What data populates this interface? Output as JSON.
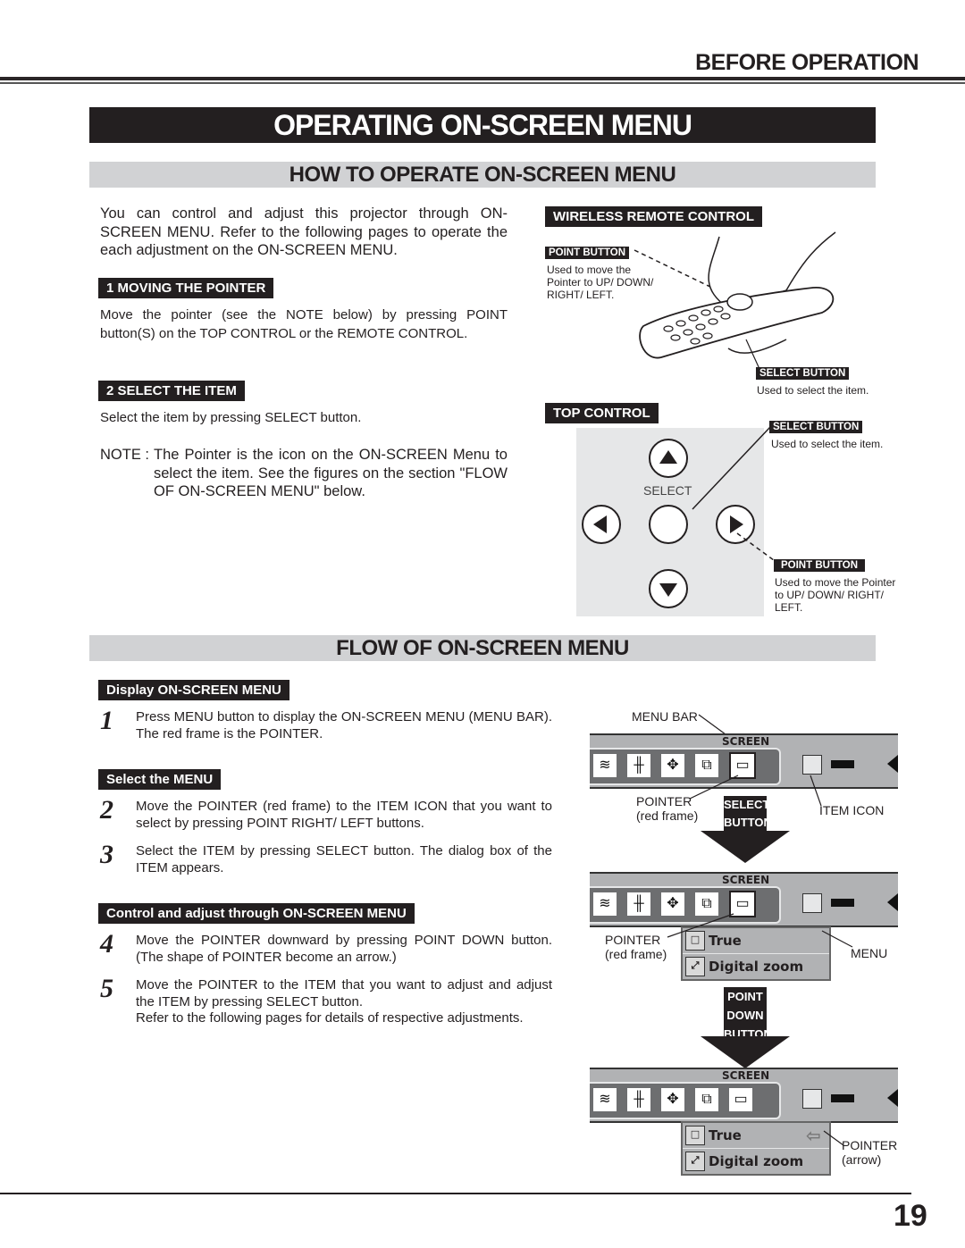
{
  "header": {
    "section": "BEFORE OPERATION",
    "title": "OPERATING ON-SCREEN MENU",
    "page_number": "19"
  },
  "how_to": {
    "heading": "HOW TO OPERATE ON-SCREEN MENU",
    "intro": "You can control and adjust this projector through ON-SCREEN MENU.  Refer to the following pages to operate the each adjustment on the ON-SCREEN MENU.",
    "step1_label": "1  MOVING THE POINTER",
    "step1_text": "Move the pointer (see the NOTE below) by pressing POINT button(S) on the TOP CONTROL or the REMOTE CONTROL.",
    "step2_label": "2  SELECT THE ITEM",
    "step2_text": "Select the item by pressing SELECT button.",
    "note_prefix": "NOTE :",
    "note_text": "The Pointer is the icon on the ON-SCREEN Menu to select the item.  See the figures on the section \"FLOW OF ON-SCREEN MENU\" below."
  },
  "remote": {
    "label": "WIRELESS REMOTE CONTROL",
    "point_button_label": "POINT BUTTON",
    "point_button_desc": "Used to move the Pointer to UP/ DOWN/ RIGHT/ LEFT.",
    "select_button_label": "SELECT BUTTON",
    "select_button_desc": "Used to select the item."
  },
  "top_control": {
    "label": "TOP CONTROL",
    "select_text": "SELECT",
    "select_button_label": "SELECT BUTTON",
    "select_button_desc": "Used to select the item.",
    "point_button_label": "POINT BUTTON",
    "point_button_desc": "Used to move the Pointer to UP/ DOWN/ RIGHT/ LEFT."
  },
  "flow": {
    "heading": "FLOW OF ON-SCREEN MENU",
    "groups": [
      {
        "label": "Display ON-SCREEN MENU"
      },
      {
        "label": "Select the MENU"
      },
      {
        "label": "Control and adjust through ON-SCREEN MENU"
      }
    ],
    "steps": [
      {
        "num": "1",
        "text": "Press MENU button to display the ON-SCREEN MENU (MENU BAR).  The red frame is the POINTER."
      },
      {
        "num": "2",
        "text": "Move the POINTER (red frame) to the ITEM ICON that you want to select by pressing POINT RIGHT/ LEFT buttons."
      },
      {
        "num": "3",
        "text": "Select the ITEM by pressing SELECT button.  The dialog box of the ITEM appears."
      },
      {
        "num": "4",
        "text": "Move the POINTER downward by pressing POINT DOWN button. (The shape of POINTER become an arrow.)"
      },
      {
        "num": "5",
        "text": "Move the POINTER to the ITEM that you want to adjust and adjust the ITEM by pressing SELECT button.",
        "extra": "Refer to the following pages for details of respective adjustments."
      }
    ]
  },
  "figures": {
    "menu_bar_title": "SCREEN",
    "callout_menu_bar": "MENU BAR",
    "callout_pointer": "POINTER",
    "callout_red_frame": "(red frame)",
    "callout_item_icon": "ITEM ICON",
    "callout_menu": "MENU",
    "callout_pointer_arrow": "POINTER",
    "callout_arrow": "(arrow)",
    "arrow1": [
      "SELECT",
      "BUTTON"
    ],
    "arrow2": [
      "POINT",
      "DOWN",
      "BUTTON"
    ],
    "menu_items": [
      "True",
      "Digital zoom"
    ],
    "menu_icons": [
      "noise-reduction-icon",
      "fine-sync-icon",
      "position-icon",
      "pc-adjust-icon",
      "screen-icon"
    ]
  }
}
